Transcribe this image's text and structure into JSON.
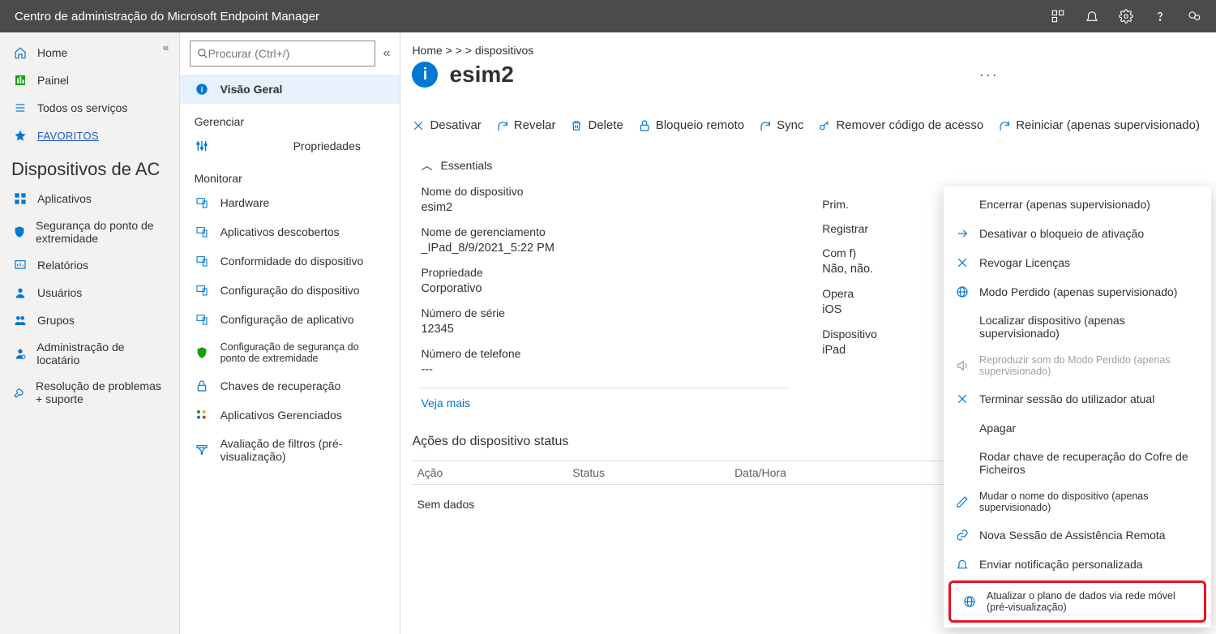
{
  "topbar": {
    "title": "Centro de administração do Microsoft Endpoint Manager"
  },
  "leftnav": {
    "items": [
      {
        "label": "Home",
        "icon": "home"
      },
      {
        "label": "Painel",
        "icon": "dashboard"
      },
      {
        "label": "Todos os serviços",
        "icon": "list"
      },
      {
        "label": "FAVORITOS",
        "icon": "star",
        "fav": true
      }
    ],
    "section_title": "Dispositivos de AC",
    "items2": [
      {
        "label": "Aplicativos",
        "icon": "grid"
      },
      {
        "label": "Segurança do ponto de extremidade",
        "icon": "shield"
      },
      {
        "label": "Relatórios",
        "icon": "report"
      },
      {
        "label": "Usuários",
        "icon": "user"
      },
      {
        "label": "Grupos",
        "icon": "group"
      },
      {
        "label": "Administração de locatário",
        "icon": "admin"
      },
      {
        "label": "Resolução de problemas + suporte",
        "icon": "wrench"
      }
    ]
  },
  "subnav": {
    "search_placeholder": "Procurar (Ctrl+/)",
    "overview": "Visão Geral",
    "manage_group": "Gerenciar",
    "manage_items": [
      {
        "label": "Propriedades",
        "icon": "sliders",
        "center": true
      }
    ],
    "monitor_group": "Monitorar",
    "monitor_items": [
      {
        "label": "Hardware",
        "icon": "device"
      },
      {
        "label": "Aplicativos descobertos",
        "icon": "device"
      },
      {
        "label": "Conformidade do dispositivo",
        "icon": "device"
      },
      {
        "label": "Configuração do dispositivo",
        "icon": "device"
      },
      {
        "label": "Configuração de aplicativo",
        "icon": "device"
      },
      {
        "label": "Configuração de segurança do ponto de extremidade",
        "icon": "shield-green",
        "small": true
      },
      {
        "label": "Chaves de recuperação",
        "icon": "lock"
      },
      {
        "label": "Aplicativos Gerenciados",
        "icon": "apps"
      },
      {
        "label": "Avaliação de filtros (pré-visualização)",
        "icon": "filter"
      }
    ]
  },
  "content": {
    "breadcrumbs": "Home &gt;   &gt; &gt; dispositivos",
    "title": "esim2",
    "commands": [
      {
        "label": "Desativar",
        "icon": "x"
      },
      {
        "label": "Revelar",
        "icon": "refresh"
      },
      {
        "label": "Delete",
        "icon": "trash"
      },
      {
        "label": "Bloqueio remoto",
        "icon": "lock"
      },
      {
        "label": "Sync",
        "icon": "refresh"
      },
      {
        "label": "Remover código de acesso",
        "icon": "key"
      },
      {
        "label": "Reiniciar (apenas supervisionado)",
        "icon": "refresh"
      }
    ],
    "essentials_label": "Essentials",
    "left_fields": [
      {
        "label": "Nome do dispositivo",
        "value": "esim2"
      },
      {
        "label": "Nome de gerenciamento",
        "value": "_IPad_8/9/2021_5:22 PM"
      },
      {
        "label": "Propriedade",
        "value": "Corporativo"
      },
      {
        "label": "Número de série",
        "value": "12345"
      },
      {
        "label": "Número de telefone",
        "value": "---"
      }
    ],
    "right_fields": [
      {
        "label": "Prim.",
        "value": ""
      },
      {
        "label": "Registrar",
        "value": ""
      },
      {
        "label": "Com f)",
        "value": "Não, não."
      },
      {
        "label": "Opera",
        "value": "iOS"
      },
      {
        "label": "Dispositivo",
        "value": "iPad"
      }
    ],
    "see_more": "Veja mais",
    "status": {
      "title": "Ações do dispositivo status",
      "cols": [
        "Ação",
        "Status",
        "Data/Hora"
      ],
      "empty": "Sem dados"
    },
    "ctxmenu": [
      {
        "label": "Encerrar (apenas supervisionado)",
        "icon": "none"
      },
      {
        "label": "Desativar o bloqueio de ativação",
        "icon": "arrow"
      },
      {
        "label": "Revogar Licenças",
        "icon": "x"
      },
      {
        "label": "Modo Perdido (apenas supervisionado)",
        "icon": "globe"
      },
      {
        "label": "Localizar dispositivo (apenas supervisionado)",
        "icon": "none"
      },
      {
        "label": "Reproduzir som do Modo Perdido (apenas supervisionado)",
        "icon": "sound",
        "disabled": true,
        "small": true
      },
      {
        "label": "Terminar sessão do utilizador atual",
        "icon": "x"
      },
      {
        "label": "Apagar",
        "icon": "none"
      },
      {
        "label": "Rodar chave de recuperação do Cofre de Ficheiros",
        "icon": "none"
      },
      {
        "label": "Mudar o nome do dispositivo (apenas supervisionado)",
        "icon": "pencil",
        "small": true
      },
      {
        "label": "Nova Sessão de Assistência Remota",
        "icon": "link"
      },
      {
        "label": "Enviar notificação personalizada",
        "icon": "bell"
      },
      {
        "label": "Atualizar o plano de dados via rede móvel (pré-visualização)",
        "icon": "globe",
        "small": true,
        "highlight": true
      }
    ]
  }
}
